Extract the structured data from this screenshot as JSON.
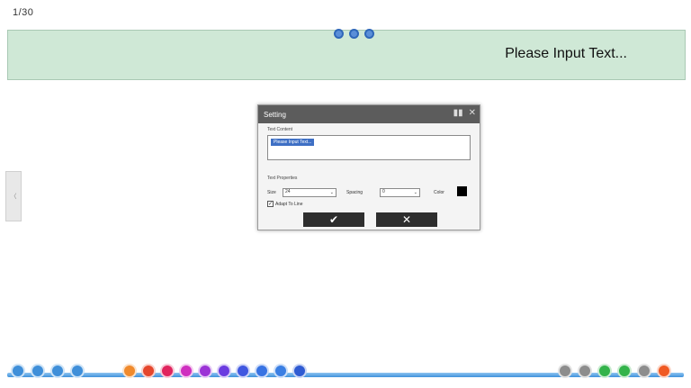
{
  "page_number": "1/30",
  "banner": {
    "text": "Please Input Text...",
    "tools": [
      "settings-icon",
      "move-icon",
      "close-icon"
    ]
  },
  "side_tab": {
    "label": "〈"
  },
  "dialog": {
    "title": "Setting",
    "controls": [
      "pin-icon",
      "close-icon"
    ],
    "close_glyph": "✕",
    "pin_glyph": "▮▮",
    "text_content_label": "Text Content",
    "text_value": "Please Input Text...",
    "text_property_label": "Text Properties",
    "size_label": "Size",
    "size_value": "24",
    "spacing_label": "Spacing",
    "spacing_value": "0",
    "color_label": "Color",
    "color_value": "#000000",
    "wrap_label": "Adapt To Line",
    "wrap_checked": "✓",
    "confirm_glyph": "✔",
    "cancel_glyph": "✕"
  },
  "toolbar": {
    "left_tools": [
      {
        "icon": "edit-icon",
        "color": "#3f8fd9"
      },
      {
        "icon": "save-icon",
        "color": "#3f8fd9"
      },
      {
        "icon": "settings-icon",
        "color": "#3f8fd9"
      },
      {
        "icon": "folder-icon",
        "color": "#3f8fd9"
      }
    ],
    "center_tools": [
      {
        "icon": "pointer-icon",
        "color": "#f08a2c"
      },
      {
        "icon": "pen-icon",
        "color": "#e5462d"
      },
      {
        "icon": "eraser-icon",
        "color": "#e0245e"
      },
      {
        "icon": "highlighter-icon",
        "color": "#cf2fbf"
      },
      {
        "icon": "shape-icon",
        "color": "#9b33d6"
      },
      {
        "icon": "color-icon",
        "color": "#6a3be0"
      },
      {
        "icon": "image-icon",
        "color": "#4057e0"
      },
      {
        "icon": "text-icon",
        "color": "#3873e3"
      },
      {
        "icon": "copy-icon",
        "color": "#3b7fe3"
      },
      {
        "icon": "delete-icon",
        "color": "#2f5bd2"
      }
    ],
    "right_tools": [
      {
        "icon": "undo-icon",
        "color": "#8d8d8d"
      },
      {
        "icon": "redo-icon",
        "color": "#8d8d8d"
      },
      {
        "icon": "prev-page-icon",
        "color": "#33b34a"
      },
      {
        "icon": "page-icon",
        "color": "#33b34a"
      },
      {
        "icon": "next-page-icon",
        "color": "#8d8d8d"
      },
      {
        "icon": "add-page-icon",
        "color": "#f05a23"
      }
    ]
  }
}
